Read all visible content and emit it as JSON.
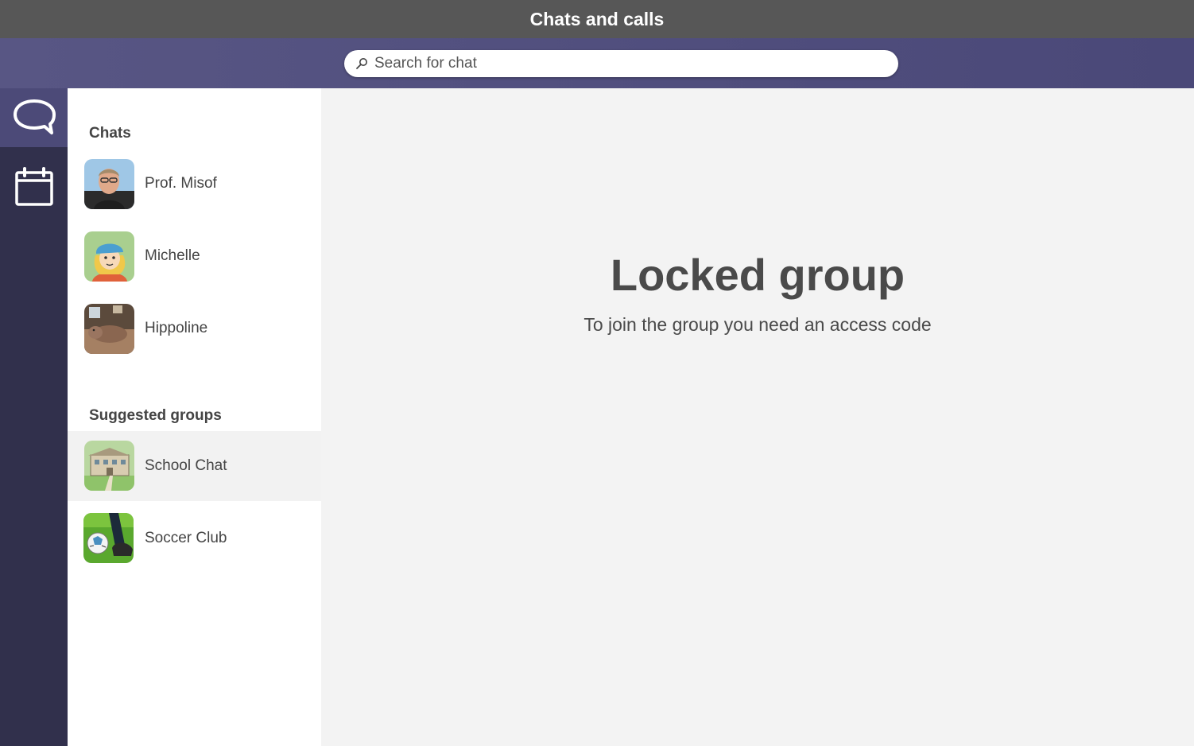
{
  "window": {
    "title": "Chats and calls"
  },
  "search": {
    "placeholder": "Search for chat",
    "icon": "search-icon"
  },
  "rail": {
    "items": [
      {
        "name": "chats",
        "icon": "chat-bubble-icon",
        "active": true
      },
      {
        "name": "calendar",
        "icon": "calendar-icon",
        "active": false
      }
    ]
  },
  "sidebar": {
    "chats_title": "Chats",
    "chats": [
      {
        "label": "Prof. Misof"
      },
      {
        "label": "Michelle"
      },
      {
        "label": "Hippoline"
      }
    ],
    "groups_title": "Suggested groups",
    "groups": [
      {
        "label": "School Chat",
        "selected": true
      },
      {
        "label": "Soccer Club",
        "selected": false
      }
    ]
  },
  "main": {
    "title": "Locked group",
    "subtitle": "To join the group you need an access code"
  },
  "colors": {
    "titlebar": "#575757",
    "searchbar": "#585684",
    "rail": "#31304c",
    "rail_active": "#4c4a78",
    "sidebar": "#ffffff",
    "main_bg": "#f3f3f3",
    "text": "#444444"
  }
}
